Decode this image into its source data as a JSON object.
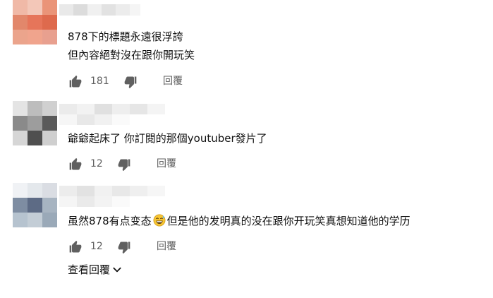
{
  "comments": [
    {
      "lines": [
        "878下的標題永遠很浮誇",
        "但內容絕對沒在跟你開玩笑"
      ],
      "likes": "181",
      "reply_label": "回覆",
      "avatar_colors": [
        "#e2876b",
        "#e6755a",
        "#eba48c",
        "#f5c9b8",
        "#f0a48d",
        "#e8a08f"
      ]
    },
    {
      "lines": [
        "爺爺起床了 你訂閱的那個youtuber發片了"
      ],
      "likes": "12",
      "reply_label": "回覆",
      "avatar_colors": [
        "#bdbdbd",
        "#8a8a8a",
        "#9d9d9d",
        "#5a5a5a",
        "#d6d6d6",
        "#cfcfcf"
      ]
    },
    {
      "lines_before_emoji": "虽然878有点变态",
      "emoji": "grinning-sweat-face-icon",
      "lines_after_emoji": "但是他的发明真的没在跟你开玩笑真想知道他的学历",
      "likes": "12",
      "reply_label": "回覆",
      "avatar_colors": [
        "#dadde3",
        "#6f7d94",
        "#7e8da2",
        "#b6c3cf",
        "#a7b4c1",
        "#c3cdd6"
      ]
    }
  ],
  "view_replies_label": "查看回覆",
  "icons": {
    "like": "thumbs-up-icon",
    "dislike": "thumbs-down-icon",
    "expand": "chevron-down-icon"
  },
  "colors": {
    "text": "#0f0f0f",
    "secondary_text": "#606060",
    "icon": "#606060"
  }
}
